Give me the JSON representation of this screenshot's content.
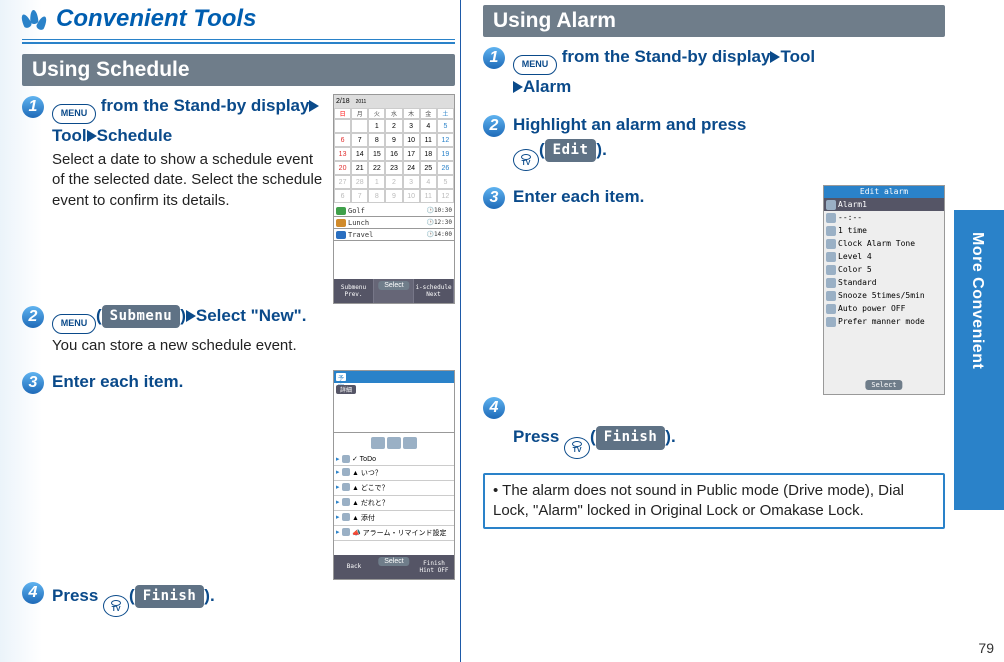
{
  "page_number": "79",
  "side_tab": "More Convenient",
  "title": "Convenient Tools",
  "left": {
    "section": "Using Schedule",
    "steps": [
      {
        "num": "1",
        "menu_label": "MENU",
        "line1_a": " from the Stand-by display",
        "line1_b": "Tool",
        "line1_c": "Schedule",
        "note": "Select a date to show a schedule event of the selected date. Select the schedule event to confirm its details."
      },
      {
        "num": "2",
        "menu_label": "MENU",
        "paren_soft": "Submenu",
        "line": "Select \"New\".",
        "note": "You can store a new schedule event."
      },
      {
        "num": "3",
        "line": "Enter each item."
      },
      {
        "num": "4",
        "cam_label": "TV",
        "line_a": "Press ",
        "paren_soft": "Finish",
        "line_b": "."
      }
    ],
    "scr1": {
      "date_label": "2/18",
      "year": "2011",
      "dow_heads": [
        "日",
        "月",
        "火",
        "水",
        "木",
        "金",
        "土"
      ],
      "rows": [
        [
          "",
          "",
          "1",
          "2",
          "3",
          "4",
          "5"
        ],
        [
          "6",
          "7",
          "8",
          "9",
          "10",
          "11",
          "12"
        ],
        [
          "13",
          "14",
          "15",
          "16",
          "17",
          "18",
          "19"
        ],
        [
          "20",
          "21",
          "22",
          "23",
          "24",
          "25",
          "26"
        ],
        [
          "27",
          "28",
          "1",
          "2",
          "3",
          "4",
          "5"
        ],
        [
          "6",
          "7",
          "8",
          "9",
          "10",
          "11",
          "12"
        ]
      ],
      "today": "18",
      "events": [
        {
          "name": "Golf",
          "time": "10:30",
          "color": "#3fa04a"
        },
        {
          "name": "Lunch",
          "time": "12:30",
          "color": "#d08a2a"
        },
        {
          "name": "Travel",
          "time": "14:00",
          "color": "#2a6fc0"
        }
      ],
      "soft_left_top": "Submenu",
      "soft_left_bottom": "Prev.",
      "soft_right_top": "i-schedule",
      "soft_right_bottom": "Next",
      "soft_center": "Select"
    },
    "scr2": {
      "tab1": "予定",
      "row_detail": "詳細",
      "list_items": [
        "✓ ToDo",
        "▲ いつ？",
        "▲ どこで？",
        "▲ だれと？",
        "▲ 添付",
        "📣 アラーム・リマインド設定"
      ],
      "soft_left": "Back",
      "soft_center": "Select",
      "soft_right_top": "Finish",
      "soft_right_bottom": "Hint OFF"
    }
  },
  "right": {
    "section": "Using Alarm",
    "steps": [
      {
        "num": "1",
        "menu_label": "MENU",
        "line1_a": " from the Stand-by display",
        "line1_b": "Tool",
        "line1_c": "Alarm"
      },
      {
        "num": "2",
        "line_a": "Highlight an alarm and press ",
        "cam_label": "TV",
        "paren_soft": " Edit ",
        "line_b": "."
      },
      {
        "num": "3",
        "line": "Enter each item."
      },
      {
        "num": "4",
        "line_a": "Press ",
        "cam_label": "TV",
        "paren_soft": "Finish",
        "line_b": "."
      }
    ],
    "scr3": {
      "title": "Edit alarm",
      "rows": [
        "Alarm1",
        "--:--",
        "1 time",
        "Clock Alarm Tone",
        "Level 4",
        "Color 5",
        "Standard",
        "Snooze 5times/5min",
        "Auto power OFF",
        "Prefer manner mode"
      ],
      "select": "Select"
    },
    "note": "The alarm does not sound in Public mode (Drive mode), Dial Lock, \"Alarm\" locked in Original Lock or Omakase Lock."
  }
}
